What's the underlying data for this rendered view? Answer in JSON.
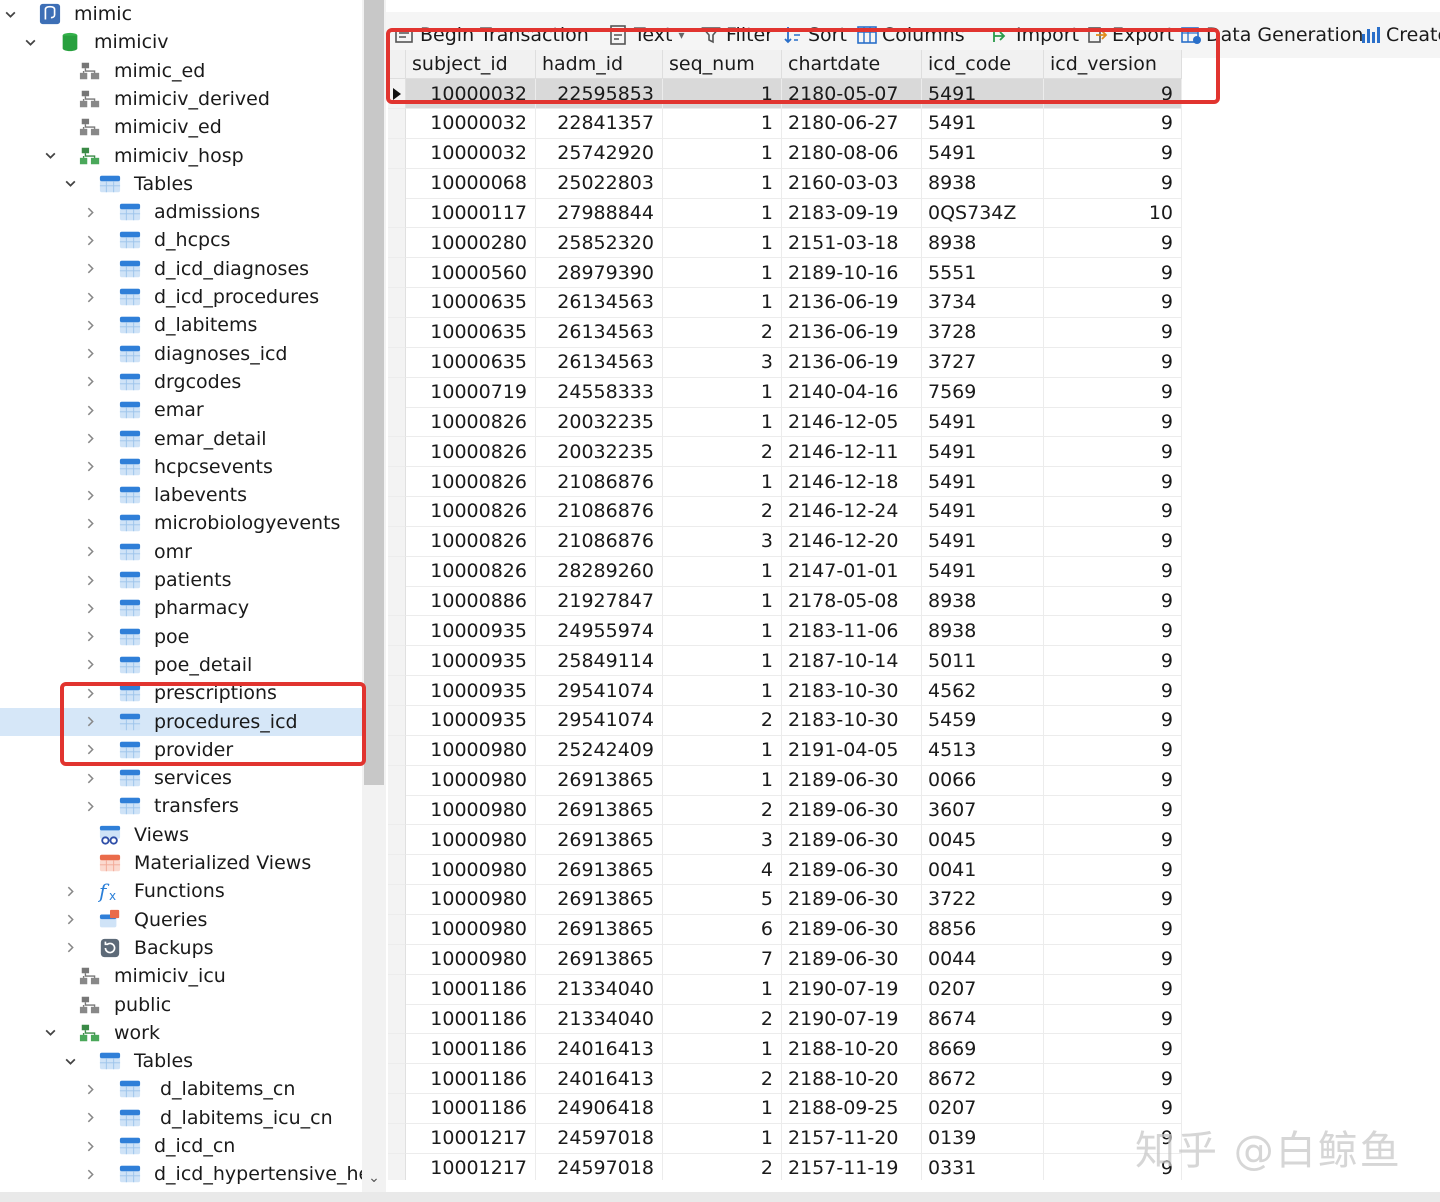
{
  "navigator": {
    "items": [
      {
        "label": "mimic",
        "icon": "postgres-elephant-icon",
        "chev": "down"
      },
      {
        "label": "mimiciv",
        "icon": "database-icon",
        "chev": "down"
      },
      {
        "label": "mimic_ed",
        "icon": "schema-icon",
        "chev": ""
      },
      {
        "label": "mimiciv_derived",
        "icon": "schema-icon",
        "chev": ""
      },
      {
        "label": "mimiciv_ed",
        "icon": "schema-icon",
        "chev": ""
      },
      {
        "label": "mimiciv_hosp",
        "icon": "schema-open-icon",
        "chev": "down"
      },
      {
        "label": "Tables",
        "icon": "tables-folder-icon",
        "chev": "down"
      },
      {
        "label": "admissions",
        "icon": "table-icon",
        "chev": "right"
      },
      {
        "label": "d_hcpcs",
        "icon": "table-icon",
        "chev": "right"
      },
      {
        "label": "d_icd_diagnoses",
        "icon": "table-icon",
        "chev": "right"
      },
      {
        "label": "d_icd_procedures",
        "icon": "table-icon",
        "chev": "right"
      },
      {
        "label": "d_labitems",
        "icon": "table-icon",
        "chev": "right"
      },
      {
        "label": "diagnoses_icd",
        "icon": "table-icon",
        "chev": "right"
      },
      {
        "label": "drgcodes",
        "icon": "table-icon",
        "chev": "right"
      },
      {
        "label": "emar",
        "icon": "table-icon",
        "chev": "right"
      },
      {
        "label": "emar_detail",
        "icon": "table-icon",
        "chev": "right"
      },
      {
        "label": "hcpcsevents",
        "icon": "table-icon",
        "chev": "right"
      },
      {
        "label": "labevents",
        "icon": "table-icon",
        "chev": "right"
      },
      {
        "label": "microbiologyevents",
        "icon": "table-icon",
        "chev": "right"
      },
      {
        "label": "omr",
        "icon": "table-icon",
        "chev": "right"
      },
      {
        "label": "patients",
        "icon": "table-icon",
        "chev": "right"
      },
      {
        "label": "pharmacy",
        "icon": "table-icon",
        "chev": "right"
      },
      {
        "label": "poe",
        "icon": "table-icon",
        "chev": "right"
      },
      {
        "label": "poe_detail",
        "icon": "table-icon",
        "chev": "right"
      },
      {
        "label": "prescriptions",
        "icon": "table-icon",
        "chev": "right"
      },
      {
        "label": "procedures_icd",
        "icon": "table-icon",
        "chev": "right"
      },
      {
        "label": "provider",
        "icon": "table-icon",
        "chev": "right"
      },
      {
        "label": "services",
        "icon": "table-icon",
        "chev": "right"
      },
      {
        "label": "transfers",
        "icon": "table-icon",
        "chev": "right"
      },
      {
        "label": "Views",
        "icon": "views-icon",
        "chev": ""
      },
      {
        "label": "Materialized Views",
        "icon": "materialized-views-icon",
        "chev": ""
      },
      {
        "label": "Functions",
        "icon": "functions-icon",
        "chev": "right"
      },
      {
        "label": "Queries",
        "icon": "queries-icon",
        "chev": "right"
      },
      {
        "label": "Backups",
        "icon": "backups-icon",
        "chev": "right"
      },
      {
        "label": "mimiciv_icu",
        "icon": "schema-icon",
        "chev": ""
      },
      {
        "label": "public",
        "icon": "schema-icon",
        "chev": ""
      },
      {
        "label": "work",
        "icon": "schema-open-icon",
        "chev": "down"
      },
      {
        "label": "Tables",
        "icon": "tables-folder-icon",
        "chev": "down"
      },
      {
        "label": "d_labitems_cn",
        "icon": "table-icon",
        "chev": "right"
      },
      {
        "label": "d_labitems_icu_cn",
        "icon": "table-icon",
        "chev": "right"
      },
      {
        "label": "d_icd_cn",
        "icon": "table-icon",
        "chev": "right"
      },
      {
        "label": "d_icd_hypertensive_heart_d",
        "icon": "table-icon",
        "chev": "right"
      }
    ],
    "selected_index": 25
  },
  "toolbar": {
    "begin_transaction": "Begin Transaction",
    "text": "Text",
    "filter": "Filter",
    "sort": "Sort",
    "columns": "Columns",
    "import": "Import",
    "export": "Export",
    "data_generation": "Data Generation",
    "create_chart": "Create"
  },
  "grid": {
    "columns": [
      "subject_id",
      "hadm_id",
      "seq_num",
      "chartdate",
      "icd_code",
      "icd_version"
    ],
    "rows": [
      [
        "10000032",
        "22595853",
        "1",
        "2180-05-07",
        "5491",
        "9"
      ],
      [
        "10000032",
        "22841357",
        "1",
        "2180-06-27",
        "5491",
        "9"
      ],
      [
        "10000032",
        "25742920",
        "1",
        "2180-08-06",
        "5491",
        "9"
      ],
      [
        "10000068",
        "25022803",
        "1",
        "2160-03-03",
        "8938",
        "9"
      ],
      [
        "10000117",
        "27988844",
        "1",
        "2183-09-19",
        "0QS734Z",
        "10"
      ],
      [
        "10000280",
        "25852320",
        "1",
        "2151-03-18",
        "8938",
        "9"
      ],
      [
        "10000560",
        "28979390",
        "1",
        "2189-10-16",
        "5551",
        "9"
      ],
      [
        "10000635",
        "26134563",
        "1",
        "2136-06-19",
        "3734",
        "9"
      ],
      [
        "10000635",
        "26134563",
        "2",
        "2136-06-19",
        "3728",
        "9"
      ],
      [
        "10000635",
        "26134563",
        "3",
        "2136-06-19",
        "3727",
        "9"
      ],
      [
        "10000719",
        "24558333",
        "1",
        "2140-04-16",
        "7569",
        "9"
      ],
      [
        "10000826",
        "20032235",
        "1",
        "2146-12-05",
        "5491",
        "9"
      ],
      [
        "10000826",
        "20032235",
        "2",
        "2146-12-11",
        "5491",
        "9"
      ],
      [
        "10000826",
        "21086876",
        "1",
        "2146-12-18",
        "5491",
        "9"
      ],
      [
        "10000826",
        "21086876",
        "2",
        "2146-12-24",
        "5491",
        "9"
      ],
      [
        "10000826",
        "21086876",
        "3",
        "2146-12-20",
        "5491",
        "9"
      ],
      [
        "10000826",
        "28289260",
        "1",
        "2147-01-01",
        "5491",
        "9"
      ],
      [
        "10000886",
        "21927847",
        "1",
        "2178-05-08",
        "8938",
        "9"
      ],
      [
        "10000935",
        "24955974",
        "1",
        "2183-11-06",
        "8938",
        "9"
      ],
      [
        "10000935",
        "25849114",
        "1",
        "2187-10-14",
        "5011",
        "9"
      ],
      [
        "10000935",
        "29541074",
        "1",
        "2183-10-30",
        "4562",
        "9"
      ],
      [
        "10000935",
        "29541074",
        "2",
        "2183-10-30",
        "5459",
        "9"
      ],
      [
        "10000980",
        "25242409",
        "1",
        "2191-04-05",
        "4513",
        "9"
      ],
      [
        "10000980",
        "26913865",
        "1",
        "2189-06-30",
        "0066",
        "9"
      ],
      [
        "10000980",
        "26913865",
        "2",
        "2189-06-30",
        "3607",
        "9"
      ],
      [
        "10000980",
        "26913865",
        "3",
        "2189-06-30",
        "0045",
        "9"
      ],
      [
        "10000980",
        "26913865",
        "4",
        "2189-06-30",
        "0041",
        "9"
      ],
      [
        "10000980",
        "26913865",
        "5",
        "2189-06-30",
        "3722",
        "9"
      ],
      [
        "10000980",
        "26913865",
        "6",
        "2189-06-30",
        "8856",
        "9"
      ],
      [
        "10000980",
        "26913865",
        "7",
        "2189-06-30",
        "0044",
        "9"
      ],
      [
        "10001186",
        "21334040",
        "1",
        "2190-07-19",
        "0207",
        "9"
      ],
      [
        "10001186",
        "21334040",
        "2",
        "2190-07-19",
        "8674",
        "9"
      ],
      [
        "10001186",
        "24016413",
        "1",
        "2188-10-20",
        "8669",
        "9"
      ],
      [
        "10001186",
        "24016413",
        "2",
        "2188-10-20",
        "8672",
        "9"
      ],
      [
        "10001186",
        "24906418",
        "1",
        "2188-09-25",
        "0207",
        "9"
      ],
      [
        "10001217",
        "24597018",
        "1",
        "2157-11-20",
        "0139",
        "9"
      ],
      [
        "10001217",
        "24597018",
        "2",
        "2157-11-19",
        "0331",
        "9"
      ]
    ],
    "current_row": 0
  },
  "watermark": "知乎 @白鲸鱼",
  "colors": {
    "highlight": "#e1342f",
    "selected": "#d6e7f8",
    "current_row": "#d9d9d9"
  }
}
